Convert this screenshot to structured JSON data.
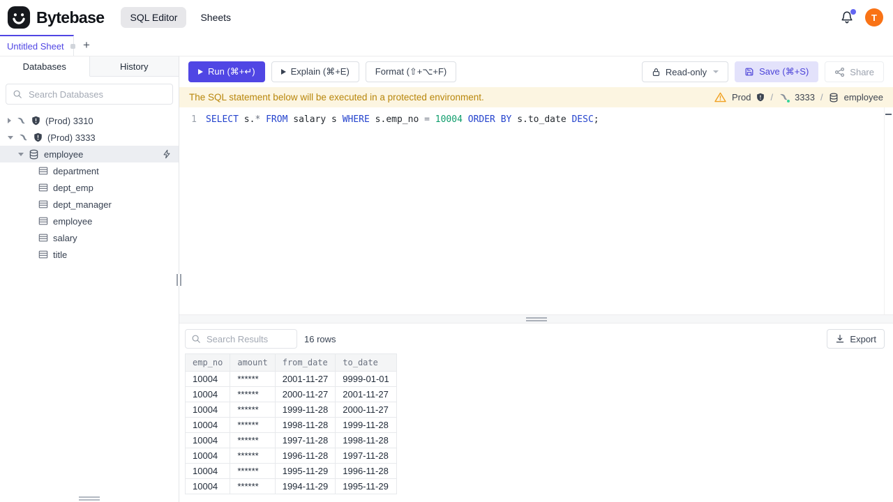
{
  "header": {
    "brand": "Bytebase",
    "nav_sql_editor": "SQL Editor",
    "nav_sheets": "Sheets",
    "avatar_initial": "T"
  },
  "tabs": {
    "sheet_title": "Untitled Sheet",
    "new_tab": "+"
  },
  "sidebar": {
    "tab_databases": "Databases",
    "tab_history": "History",
    "search_placeholder": "Search Databases",
    "tree": {
      "instances": [
        {
          "label": "(Prod) 3310",
          "expanded": false
        },
        {
          "label": "(Prod) 3333",
          "expanded": true
        }
      ],
      "database": {
        "label": "employee",
        "selected": true
      },
      "tables": [
        {
          "label": "department"
        },
        {
          "label": "dept_emp"
        },
        {
          "label": "dept_manager"
        },
        {
          "label": "employee"
        },
        {
          "label": "salary"
        },
        {
          "label": "title"
        }
      ]
    }
  },
  "toolbar": {
    "run_label": "Run (⌘+↵)",
    "explain_label": "Explain (⌘+E)",
    "format_label": "Format (⇧+⌥+F)",
    "readonly_label": "Read-only",
    "save_label": "Save (⌘+S)",
    "share_label": "Share"
  },
  "banner": {
    "message": "The SQL statement below will be executed in a protected environment.",
    "environment": "Prod",
    "instance": "3333",
    "database": "employee",
    "separator": "/"
  },
  "editor": {
    "line_number": "1",
    "sql": "SELECT s.* FROM salary s WHERE s.emp_no = 10004 ORDER BY s.to_date DESC;",
    "tokens": [
      {
        "text": "SELECT",
        "type": "keyword"
      },
      {
        "text": " s.",
        "type": "plain"
      },
      {
        "text": "*",
        "type": "operator"
      },
      {
        "text": " FROM",
        "type": "keyword"
      },
      {
        "text": " salary s ",
        "type": "plain"
      },
      {
        "text": "WHERE",
        "type": "keyword"
      },
      {
        "text": " s.emp_no ",
        "type": "plain"
      },
      {
        "text": "=",
        "type": "operator"
      },
      {
        "text": " ",
        "type": "plain"
      },
      {
        "text": "10004",
        "type": "number"
      },
      {
        "text": " ORDER BY",
        "type": "keyword"
      },
      {
        "text": " s.to_date ",
        "type": "plain"
      },
      {
        "text": "DESC",
        "type": "keyword"
      },
      {
        "text": ";",
        "type": "plain"
      }
    ]
  },
  "results": {
    "search_placeholder": "Search Results",
    "row_count": "16 rows",
    "export_label": "Export",
    "columns": [
      "emp_no",
      "amount",
      "from_date",
      "to_date"
    ],
    "rows": [
      [
        "10004",
        "******",
        "2001-11-27",
        "9999-01-01"
      ],
      [
        "10004",
        "******",
        "2000-11-27",
        "2001-11-27"
      ],
      [
        "10004",
        "******",
        "1999-11-28",
        "2000-11-27"
      ],
      [
        "10004",
        "******",
        "1998-11-28",
        "1999-11-28"
      ],
      [
        "10004",
        "******",
        "1997-11-28",
        "1998-11-28"
      ],
      [
        "10004",
        "******",
        "1996-11-28",
        "1997-11-28"
      ],
      [
        "10004",
        "******",
        "1995-11-29",
        "1996-11-28"
      ],
      [
        "10004",
        "******",
        "1994-11-29",
        "1995-11-29"
      ]
    ]
  },
  "colors": {
    "accent_purple": "#5046e4",
    "save_button_bg": "#e3e2fb",
    "banner_bg": "#fcf5e1",
    "banner_text": "#b8860b",
    "keyword_blue": "#2443cd",
    "number_green": "#0f9d6c",
    "avatar_orange": "#f97316",
    "warning_amber": "#f0a020",
    "status_green": "#34d399",
    "notification_dot": "#6366f1"
  }
}
